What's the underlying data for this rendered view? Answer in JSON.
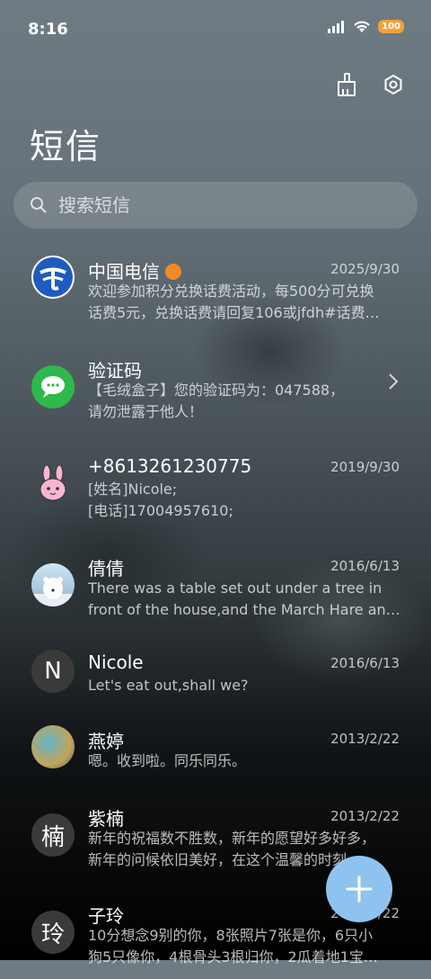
{
  "status_bar": {
    "time": "8:16",
    "battery": "100"
  },
  "header": {
    "title": "短信"
  },
  "search": {
    "placeholder": "搜索短信"
  },
  "conversations": [
    {
      "name": "中国电信",
      "date": "2025/9/30",
      "line1": "欢迎参加积分兑换话费活动，每500分可兑换",
      "line2": "话费5元，兑换话费请回复106或jfdh#话费…"
    },
    {
      "name": "验证码",
      "date": "",
      "line1": "【毛绒盒子】您的验证码为：047588，",
      "line2": "请勿泄露于他人！"
    },
    {
      "name": "+8613261230775",
      "date": "2019/9/30",
      "line1": "[姓名]Nicole;",
      "line2": "[电话]17004957610;"
    },
    {
      "name": "倩倩",
      "date": "2016/6/13",
      "line1": "There was a table set out under a tree in",
      "line2": "front of the house,and the March Hare an…"
    },
    {
      "name": "Nicole",
      "date": "2016/6/13",
      "line1": "Let's eat out,shall we?",
      "line2": "",
      "avatar_letter": "N"
    },
    {
      "name": "燕婷",
      "date": "2013/2/22",
      "line1": "嗯。收到啦。同乐同乐。",
      "line2": ""
    },
    {
      "name": "紫楠",
      "date": "2013/2/22",
      "line1": "新年的祝福数不胜数，新年的愿望好多好多，",
      "line2": "新年的问候依旧美好，在这个温馨的时刻…",
      "avatar_letter": "楠"
    },
    {
      "name": "子玲",
      "date": "2013/2/22",
      "line1": "10分想念9别的你，8张照片7张是你，6只小",
      "line2": "狗5只像你，4根骨头3根归你，2瓜着地1宝…",
      "avatar_letter": "玲"
    }
  ],
  "colors": {
    "fab": "#8fc3ef",
    "telecom_blue": "#1d5bbf",
    "wechat_green": "#2fb84b"
  }
}
